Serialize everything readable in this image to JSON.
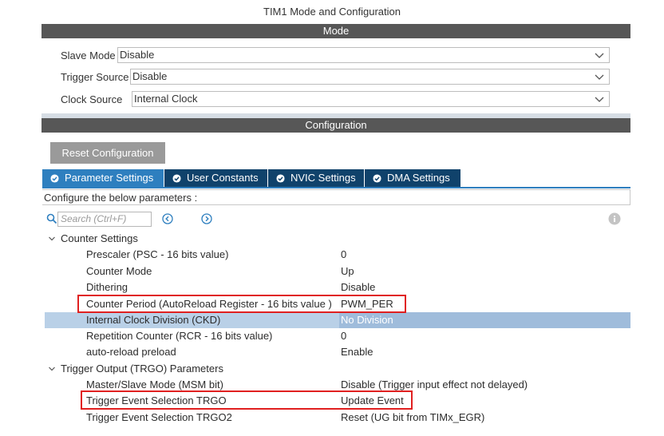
{
  "window_title": "TIM1 Mode and Configuration",
  "mode_header": "Mode",
  "mode": {
    "slave_mode": {
      "label": "Slave Mode",
      "value": "Disable"
    },
    "trigger_source": {
      "label": "Trigger Source",
      "value": "Disable"
    },
    "clock_source": {
      "label": "Clock Source",
      "value": "Internal Clock"
    }
  },
  "configuration_header": "Configuration",
  "reset_button": "Reset Configuration",
  "tabs": [
    {
      "label": "Parameter Settings",
      "active": true
    },
    {
      "label": "User Constants",
      "active": false
    },
    {
      "label": "NVIC Settings",
      "active": false
    },
    {
      "label": "DMA Settings",
      "active": false
    }
  ],
  "configure_hint": "Configure the below parameters :",
  "search": {
    "placeholder": "Search (Ctrl+F)"
  },
  "groups": [
    {
      "label": "Counter Settings",
      "params": [
        {
          "name": "Prescaler (PSC - 16 bits value)",
          "value": "0"
        },
        {
          "name": "Counter Mode",
          "value": "Up"
        },
        {
          "name": "Dithering",
          "value": "Disable"
        },
        {
          "name": "Counter Period (AutoReload Register - 16 bits value )",
          "value": "PWM_PER"
        },
        {
          "name": "Internal Clock Division (CKD)",
          "value": "No Division"
        },
        {
          "name": "Repetition Counter (RCR - 16 bits value)",
          "value": "0"
        },
        {
          "name": "auto-reload preload",
          "value": "Enable"
        }
      ]
    },
    {
      "label": "Trigger Output (TRGO) Parameters",
      "params": [
        {
          "name": "Master/Slave Mode (MSM bit)",
          "value": "Disable (Trigger input effect not delayed)"
        },
        {
          "name": "Trigger Event Selection TRGO",
          "value": "Update Event"
        },
        {
          "name": "Trigger Event Selection TRGO2",
          "value": "Reset (UG bit from TIMx_EGR)"
        }
      ]
    }
  ],
  "colors": {
    "header_bar": "#575757",
    "tab_active": "#2e7fbf",
    "tab_inactive": "#10426b",
    "selected_row": "#b9d0e7",
    "annotation_box": "#e02020"
  },
  "icons": [
    "search-icon",
    "prev-arrow-icon",
    "next-arrow-icon",
    "info-icon",
    "chevron-down-icon",
    "check-circle-icon",
    "collapse-arrow-icon"
  ]
}
